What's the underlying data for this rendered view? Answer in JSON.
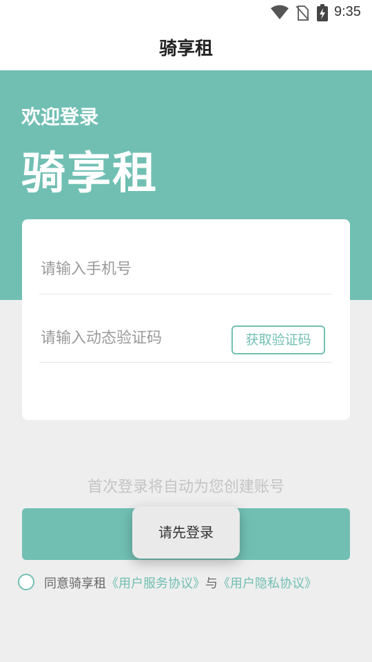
{
  "status_bar": {
    "time": "9:35",
    "icons": [
      "wifi-icon",
      "no-sim-icon",
      "battery-charging-icon"
    ]
  },
  "header": {
    "title": "骑享租"
  },
  "hero": {
    "welcome": "欢迎登录",
    "app_name": "骑享租"
  },
  "form": {
    "phone_placeholder": "请输入手机号",
    "code_placeholder": "请输入动态验证码",
    "get_code_label": "获取验证码"
  },
  "hint": "首次登录将自动为您创建账号",
  "toast": "请先登录",
  "agreement": {
    "prefix": "同意骑享租",
    "service_link": "《用户服务协议》",
    "joiner": "与",
    "privacy_link": "《用户隐私协议》",
    "checked": false
  },
  "colors": {
    "accent": "#71bfb3",
    "background": "#eeeeee",
    "card": "#ffffff"
  }
}
